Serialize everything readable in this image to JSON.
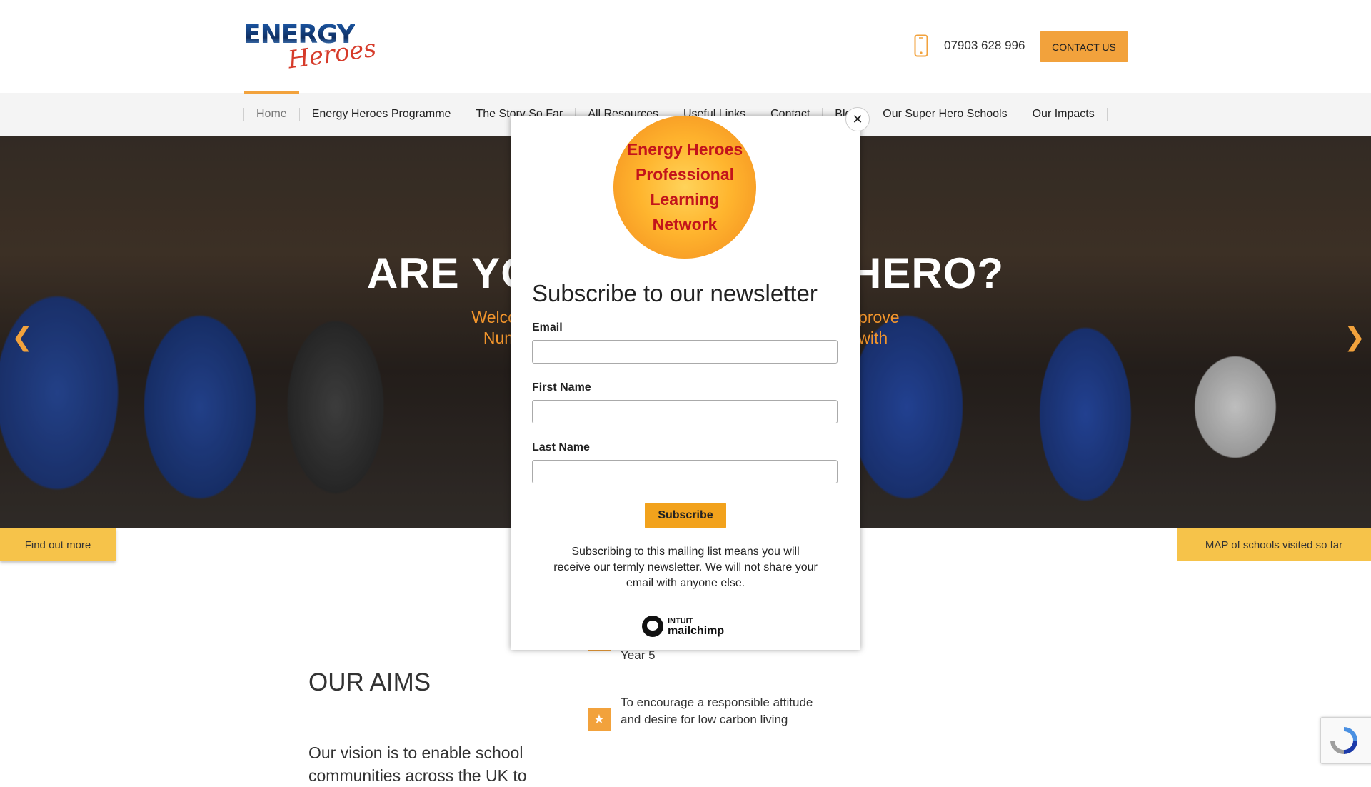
{
  "header": {
    "logo_top": "ENERGY",
    "logo_bottom": "Heroes",
    "phone": "07903 628 996",
    "contact_label": "CONTACT US",
    "accent_color": "#f2a23c"
  },
  "nav": {
    "items": [
      {
        "label": "Home",
        "active": true
      },
      {
        "label": "Energy Heroes Programme"
      },
      {
        "label": "The Story So Far"
      },
      {
        "label": "All Resources"
      },
      {
        "label": "Useful Links"
      },
      {
        "label": "Contact"
      },
      {
        "label": "Blog"
      },
      {
        "label": "Our Super Hero Schools"
      },
      {
        "label": "Our Impacts"
      }
    ]
  },
  "hero": {
    "title": "ARE YOU AN ENERGY HERO?",
    "subtitle_line1": "Welcome to our interactive resources, designed to improve",
    "subtitle_line2": "Numeracy and Science skills in an area associated with",
    "prev_icon": "chevron-left-icon",
    "next_icon": "chevron-right-icon",
    "find_out_more": "Find out more",
    "map_label": "MAP of schools visited so far"
  },
  "content": {
    "aims_title": "OUR AIMS",
    "vision_text": "Our vision is to enable school communities across the UK to",
    "bullet_top": "Year 5",
    "bullet_text": "To encourage a responsible attitude and desire for low carbon living",
    "bullet_icon": "star-icon"
  },
  "modal": {
    "badge_text": "Energy Heroes Professional Learning Network",
    "close_icon": "close-icon",
    "title": "Subscribe to our newsletter",
    "email_label": "Email",
    "email_value": "",
    "first_name_label": "First Name",
    "first_name_value": "",
    "last_name_label": "Last Name",
    "last_name_value": "",
    "subscribe_label": "Subscribe",
    "note": "Subscribing to this mailing list means you will receive our termly newsletter. We will not share your email with anyone else.",
    "provider_top": "INTUIT",
    "provider_brand": "mailchimp"
  }
}
